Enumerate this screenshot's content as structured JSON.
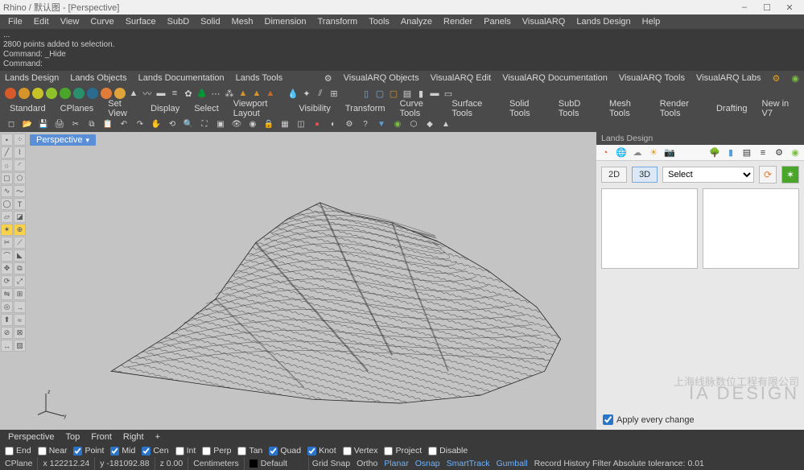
{
  "title": "Rhino / 默认图 - [Perspective]",
  "menu": [
    "File",
    "Edit",
    "View",
    "Curve",
    "Surface",
    "SubD",
    "Solid",
    "Mesh",
    "Dimension",
    "Transform",
    "Tools",
    "Analyze",
    "Render",
    "Panels",
    "VisualARQ",
    "Lands Design",
    "Help"
  ],
  "cmd": {
    "l1": "...",
    "l2": "2800 points added to selection.",
    "l3": "Command: _Hide",
    "l4": "Command:"
  },
  "tabsLeft": [
    "Lands Design",
    "Lands Objects",
    "Lands Documentation",
    "Lands Tools"
  ],
  "tabsRight": [
    "VisualARQ Objects",
    "VisualARQ Edit",
    "VisualARQ Documentation",
    "VisualARQ Tools",
    "VisualARQ Labs"
  ],
  "namedtabs": [
    "Standard",
    "CPlanes",
    "Set View",
    "Display",
    "Select",
    "Viewport Layout",
    "Visibility",
    "Transform",
    "Curve Tools",
    "Surface Tools",
    "Solid Tools",
    "SubD Tools",
    "Mesh Tools",
    "Render Tools",
    "Drafting",
    "New in V7"
  ],
  "viewport": {
    "label": "Perspective"
  },
  "rightpanel": {
    "title": "Lands Design",
    "modes": {
      "d2": "2D",
      "d3": "3D"
    },
    "select": "Select",
    "apply": "Apply every change"
  },
  "viewtabs": [
    "Perspective",
    "Top",
    "Front",
    "Right",
    "+"
  ],
  "osnaps": [
    {
      "label": "End",
      "checked": false
    },
    {
      "label": "Near",
      "checked": false
    },
    {
      "label": "Point",
      "checked": true
    },
    {
      "label": "Mid",
      "checked": true
    },
    {
      "label": "Cen",
      "checked": true
    },
    {
      "label": "Int",
      "checked": false
    },
    {
      "label": "Perp",
      "checked": false
    },
    {
      "label": "Tan",
      "checked": false
    },
    {
      "label": "Quad",
      "checked": true
    },
    {
      "label": "Knot",
      "checked": true
    },
    {
      "label": "Vertex",
      "checked": false
    },
    {
      "label": "Project",
      "checked": false
    },
    {
      "label": "Disable",
      "checked": false
    }
  ],
  "status": {
    "cplane": "CPlane",
    "x": "x 122212.24",
    "y": "y -181092.88",
    "z": "z 0.00",
    "units": "Centimeters",
    "layer": "Default",
    "snapitems": [
      "Grid Snap",
      "Ortho",
      "Planar",
      "Osnap",
      "SmartTrack",
      "Gumball"
    ],
    "rest": "Record History Filter Absolute tolerance: 0.01"
  },
  "watermark": {
    "line1": "上海线脉数位工程有限公司",
    "line2": "IA   DESIGN"
  }
}
